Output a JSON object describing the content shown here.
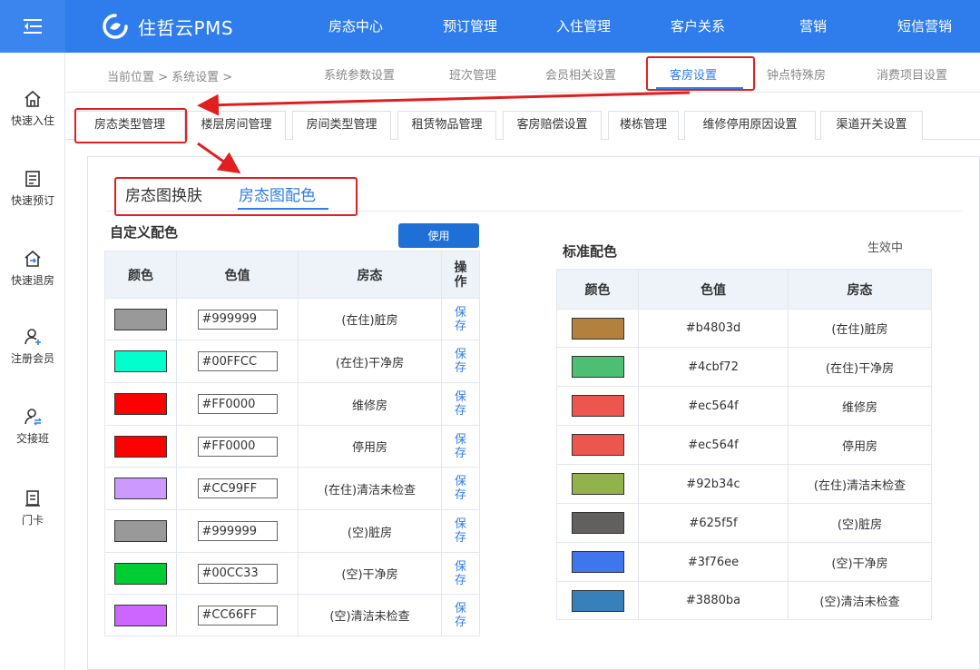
{
  "app": {
    "brand": "住哲云PMS"
  },
  "header": {
    "nav": [
      "房态中心",
      "预订管理",
      "入住管理",
      "客户关系",
      "营销",
      "短信营销"
    ]
  },
  "sidebar": {
    "items": [
      {
        "label": "快速入住",
        "icon": "home-icon"
      },
      {
        "label": "快速预订",
        "icon": "document-icon"
      },
      {
        "label": "快速退房",
        "icon": "checkout-house-icon"
      },
      {
        "label": "注册会员",
        "icon": "add-user-icon"
      },
      {
        "label": "交接班",
        "icon": "handover-user-icon"
      },
      {
        "label": "门卡",
        "icon": "room-card-icon"
      }
    ]
  },
  "breadcrumb": {
    "text": "当前位置 > 系统设置 >"
  },
  "subnav": {
    "items": [
      "系统参数设置",
      "班次管理",
      "会员相关设置",
      "客房设置",
      "钟点特殊房",
      "消费项目设置"
    ],
    "active": "客房设置"
  },
  "tabs": {
    "items": [
      "房态类型管理",
      "楼层房间管理",
      "房间类型管理",
      "租赁物品管理",
      "客房赔偿设置",
      "楼栋管理",
      "维修停用原因设置",
      "渠道开关设置"
    ],
    "active": "房态类型管理"
  },
  "inner_tabs": {
    "items": [
      "房态图换肤",
      "房态图配色"
    ],
    "active": "房态图配色"
  },
  "custom": {
    "title": "自定义配色",
    "use_button": "使用",
    "headers": [
      "颜色",
      "色值",
      "房态",
      "操作"
    ],
    "save_label": "保存",
    "rows": [
      {
        "color": "#999999",
        "value": "#999999",
        "status": "(在住)脏房"
      },
      {
        "color": "#00FFCC",
        "value": "#00FFCC",
        "status": "(在住)干净房"
      },
      {
        "color": "#FF0000",
        "value": "#FF0000",
        "status": "维修房"
      },
      {
        "color": "#FF0000",
        "value": "#FF0000",
        "status": "停用房"
      },
      {
        "color": "#CC99FF",
        "value": "#CC99FF",
        "status": "(在住)清洁未检查"
      },
      {
        "color": "#999999",
        "value": "#999999",
        "status": "(空)脏房"
      },
      {
        "color": "#00CC33",
        "value": "#00CC33",
        "status": "(空)干净房"
      },
      {
        "color": "#CC66FF",
        "value": "#CC66FF",
        "status": "(空)清洁未检查"
      }
    ]
  },
  "standard": {
    "title": "标准配色",
    "status": "生效中",
    "headers": [
      "颜色",
      "色值",
      "房态"
    ],
    "rows": [
      {
        "color": "#b4803d",
        "value": "#b4803d",
        "status": "(在住)脏房"
      },
      {
        "color": "#4cbf72",
        "value": "#4cbf72",
        "status": "(在住)干净房"
      },
      {
        "color": "#ec564f",
        "value": "#ec564f",
        "status": "维修房"
      },
      {
        "color": "#ec564f",
        "value": "#ec564f",
        "status": "停用房"
      },
      {
        "color": "#92b34c",
        "value": "#92b34c",
        "status": "(在住)清洁未检查"
      },
      {
        "color": "#625f5f",
        "value": "#625f5f",
        "status": "(空)脏房"
      },
      {
        "color": "#3f76ee",
        "value": "#3f76ee",
        "status": "(空)干净房"
      },
      {
        "color": "#3880ba",
        "value": "#3880ba",
        "status": "(空)清洁未检查"
      }
    ]
  },
  "colors": {
    "brand": "#2f7dec",
    "annotation": "#e02020",
    "header_bg": "#eef3fa"
  }
}
